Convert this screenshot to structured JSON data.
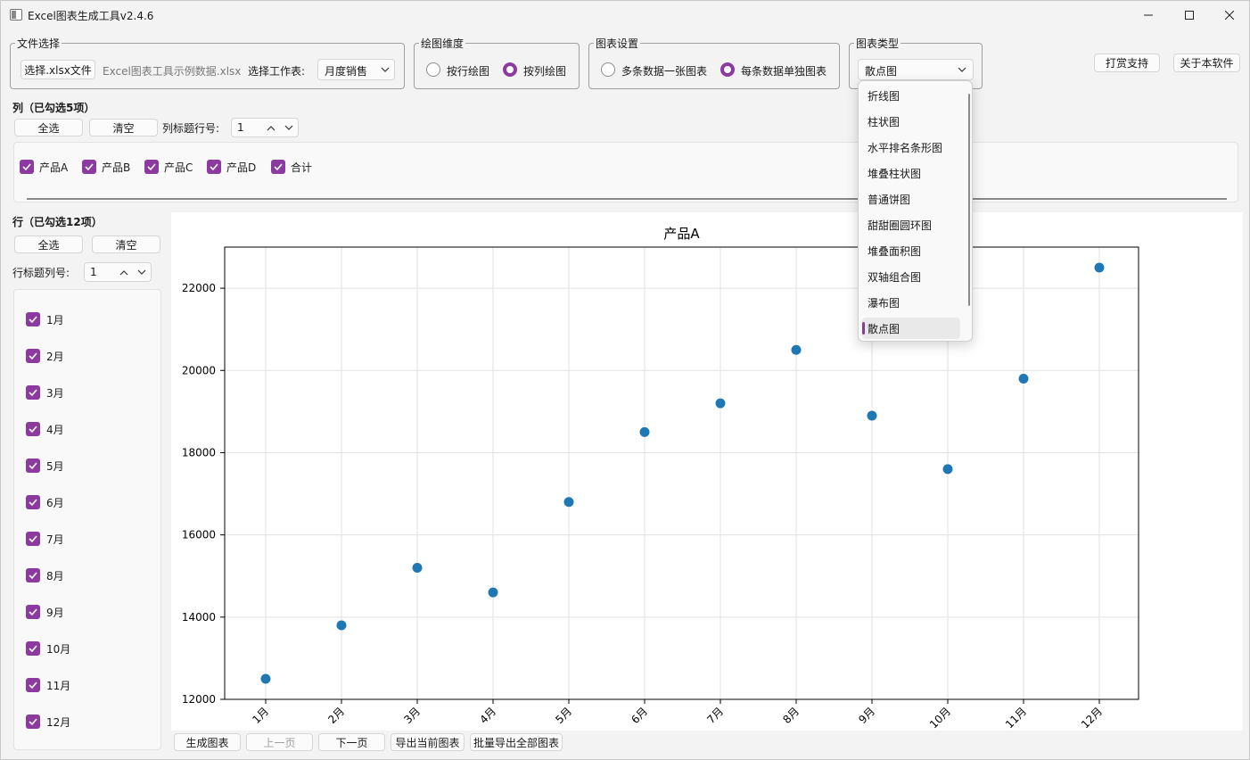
{
  "window": {
    "title": "Excel图表生成工具v2.4.6"
  },
  "file_group": {
    "legend": "文件选择",
    "choose_button": "选择.xlsx文件",
    "filename": "Excel图表工具示例数据.xlsx",
    "sheet_label": "选择工作表:",
    "sheet_value": "月度销售"
  },
  "dimension_group": {
    "legend": "绘图维度",
    "by_row": "按行绘图",
    "by_col": "按列绘图"
  },
  "settings_group": {
    "legend": "图表设置",
    "multi": "多条数据一张图表",
    "single": "每条数据单独图表"
  },
  "type_group": {
    "legend": "图表类型",
    "value": "散点图",
    "options": [
      "折线图",
      "柱状图",
      "水平排名条形图",
      "堆叠柱状图",
      "普通饼图",
      "甜甜圈圆环图",
      "堆叠面积图",
      "双轴组合图",
      "瀑布图",
      "散点图"
    ]
  },
  "top_buttons": {
    "donate": "打赏支持",
    "about": "关于本软件"
  },
  "columns": {
    "title": "列（已勾选5项）",
    "select_all": "全选",
    "clear": "清空",
    "header_row_label": "列标题行号:",
    "header_row_value": "1",
    "items": [
      "产品A",
      "产品B",
      "产品C",
      "产品D",
      "合计"
    ]
  },
  "rows": {
    "title": "行（已勾选12项）",
    "select_all": "全选",
    "clear": "清空",
    "header_col_label": "行标题列号:",
    "header_col_value": "1",
    "items": [
      "1月",
      "2月",
      "3月",
      "4月",
      "5月",
      "6月",
      "7月",
      "8月",
      "9月",
      "10月",
      "11月",
      "12月"
    ]
  },
  "bottom_buttons": {
    "generate": "生成图表",
    "prev": "上一页",
    "next": "下一页",
    "export_current": "导出当前图表",
    "export_all": "批量导出全部图表"
  },
  "chart_data": {
    "type": "scatter",
    "title": "产品A",
    "categories": [
      "1月",
      "2月",
      "3月",
      "4月",
      "5月",
      "6月",
      "7月",
      "8月",
      "9月",
      "10月",
      "11月",
      "12月"
    ],
    "values": [
      12500,
      13800,
      15200,
      14600,
      16800,
      18500,
      19200,
      20500,
      18900,
      17600,
      19800,
      22500
    ],
    "ylim": [
      12000,
      23000
    ],
    "yticks": [
      12000,
      14000,
      16000,
      18000,
      20000,
      22000
    ],
    "grid": true,
    "color": "#1f77b4"
  },
  "colors": {
    "accent": "#8d3aa0"
  }
}
